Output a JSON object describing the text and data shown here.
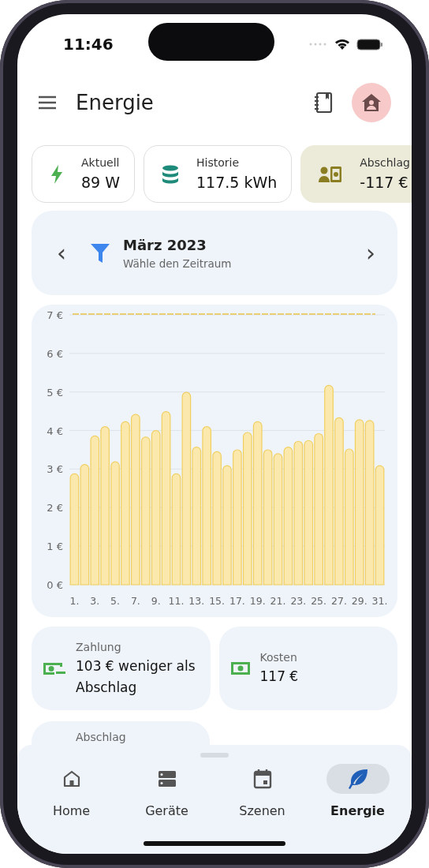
{
  "status_bar": {
    "time": "11:46"
  },
  "app_bar": {
    "title": "Energie"
  },
  "chips": [
    {
      "kind": "power",
      "label": "Aktuell",
      "value": "89 W",
      "selected": false
    },
    {
      "kind": "history",
      "label": "Historie",
      "value": "117.5 kWh",
      "selected": false
    },
    {
      "kind": "payment",
      "label": "Abschlag",
      "value": "-117 €",
      "selected": true
    }
  ],
  "period": {
    "prev": "‹",
    "title": "März 2023",
    "subtitle": "Wähle den Zeitraum",
    "next": "›"
  },
  "chart_data": {
    "type": "bar",
    "x": [
      1,
      2,
      3,
      4,
      5,
      6,
      7,
      8,
      9,
      10,
      11,
      12,
      13,
      14,
      15,
      16,
      17,
      18,
      19,
      20,
      21,
      22,
      23,
      24,
      25,
      26,
      27,
      28,
      29,
      30,
      31
    ],
    "values": [
      2.88,
      3.12,
      3.86,
      4.1,
      3.19,
      4.23,
      4.42,
      3.83,
      4.0,
      4.49,
      2.88,
      4.99,
      3.57,
      4.1,
      3.45,
      3.09,
      3.5,
      3.95,
      4.23,
      3.5,
      3.4,
      3.57,
      3.72,
      3.74,
      3.92,
      5.17,
      4.33,
      3.52,
      4.28,
      4.26,
      3.09
    ],
    "ylim": [
      0,
      7
    ],
    "yticks": [
      {
        "value": 0,
        "label": "0 €"
      },
      {
        "value": 1,
        "label": "1 €"
      },
      {
        "value": 2,
        "label": "2 €"
      },
      {
        "value": 3,
        "label": "3 €"
      },
      {
        "value": 4,
        "label": "4 €"
      },
      {
        "value": 5,
        "label": "5 €"
      },
      {
        "value": 6,
        "label": "6 €"
      },
      {
        "value": 7,
        "label": "7 €"
      }
    ],
    "xticks": [
      {
        "value": 1,
        "label": "1."
      },
      {
        "value": 3,
        "label": "3."
      },
      {
        "value": 5,
        "label": "5."
      },
      {
        "value": 7,
        "label": "7."
      },
      {
        "value": 9,
        "label": "9."
      },
      {
        "value": 11,
        "label": "11."
      },
      {
        "value": 13,
        "label": "13."
      },
      {
        "value": 15,
        "label": "15."
      },
      {
        "value": 17,
        "label": "17."
      },
      {
        "value": 19,
        "label": "19."
      },
      {
        "value": 21,
        "label": "21."
      },
      {
        "value": 23,
        "label": "23."
      },
      {
        "value": 25,
        "label": "25."
      },
      {
        "value": 27,
        "label": "27."
      },
      {
        "value": 29,
        "label": "29."
      },
      {
        "value": 31,
        "label": "31."
      }
    ],
    "xlim": [
      0.5,
      31.5
    ],
    "grid": true
  },
  "summary": [
    {
      "kind": "payment",
      "label": "Zahlung",
      "value": "103 € weniger als Abschlag"
    },
    {
      "kind": "cost",
      "label": "Kosten",
      "value": "117 €"
    },
    {
      "kind": "partial",
      "label": "Abschlag"
    }
  ],
  "bottom_nav": [
    {
      "kind": "home",
      "label": "Home",
      "selected": false
    },
    {
      "kind": "devices",
      "label": "Geräte",
      "selected": false
    },
    {
      "kind": "scenes",
      "label": "Szenen",
      "selected": false
    },
    {
      "kind": "energy",
      "label": "Energie",
      "selected": true
    }
  ]
}
